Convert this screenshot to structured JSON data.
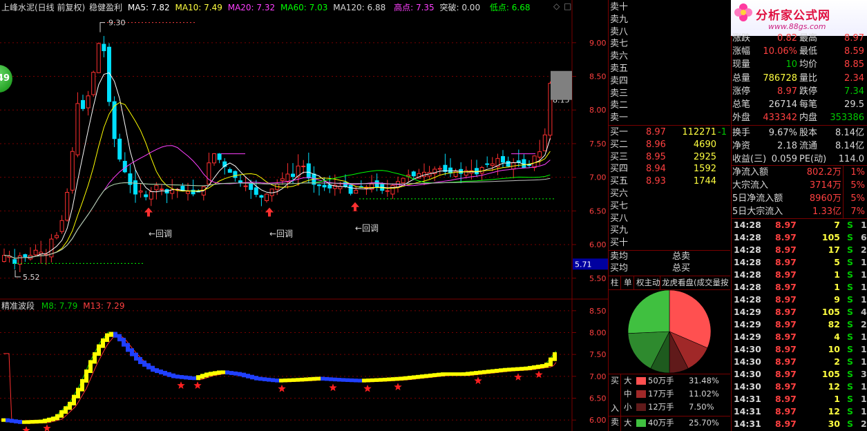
{
  "header": {
    "stock": "上峰水泥(日线 前复权)",
    "indicator": "稳健盈利",
    "ma5": "MA5: 7.82",
    "ma10": "MA10: 7.49",
    "ma20": "MA20: 7.32",
    "ma60": "MA60: 7.03",
    "ma120": "MA120: 6.88",
    "high": "高点: 7.35",
    "breakout": "突破: 0.00",
    "low": "低点: 6.68",
    "window_btn1": "◇",
    "window_btn2": "□"
  },
  "main_chart": {
    "label_high": "9.30",
    "label_low": "5.52",
    "label_last": "8.15",
    "badge": "49",
    "pullback_label": "←回调",
    "price_box": "5.71",
    "y_ticks": [
      "9.00",
      "8.50",
      "8.00",
      "7.50",
      "7.00",
      "6.50",
      "6.00",
      "5.50"
    ],
    "y_range": [
      5.2,
      9.45
    ]
  },
  "sub_chart": {
    "title": "精准波段",
    "m8": "M8: 7.79",
    "m13": "M13: 7.29",
    "y_ticks": [
      "8.50",
      "8.00",
      "7.50",
      "7.00",
      "6.50",
      "6.00"
    ],
    "y_range": [
      5.75,
      8.75
    ]
  },
  "colors": {
    "up": "#ff3030",
    "down": "#00e0ff",
    "grid": "#7a0000",
    "ma5": "#ffffff",
    "ma10": "#ffff00",
    "ma20": "#ff40ff",
    "ma60": "#00ff00",
    "ma120": "#c0c0c0"
  },
  "order_book": {
    "asks": [
      {
        "label": "卖十"
      },
      {
        "label": "卖九"
      },
      {
        "label": "卖八"
      },
      {
        "label": "卖七"
      },
      {
        "label": "卖六"
      },
      {
        "label": "卖五"
      },
      {
        "label": "卖四"
      },
      {
        "label": "卖三"
      },
      {
        "label": "卖二"
      },
      {
        "label": "卖一"
      }
    ],
    "bids": [
      {
        "label": "买一",
        "price": "8.97",
        "vol": "112271",
        "chg": "-1"
      },
      {
        "label": "买二",
        "price": "8.96",
        "vol": "4690",
        "chg": ""
      },
      {
        "label": "买三",
        "price": "8.95",
        "vol": "2925",
        "chg": ""
      },
      {
        "label": "买四",
        "price": "8.94",
        "vol": "1592",
        "chg": ""
      },
      {
        "label": "买五",
        "price": "8.93",
        "vol": "1744",
        "chg": ""
      },
      {
        "label": "买六",
        "price": "",
        "vol": "",
        "chg": ""
      },
      {
        "label": "买七",
        "price": "",
        "vol": "",
        "chg": ""
      },
      {
        "label": "买八",
        "price": "",
        "vol": "",
        "chg": ""
      },
      {
        "label": "买九",
        "price": "",
        "vol": "",
        "chg": ""
      },
      {
        "label": "买十",
        "price": "",
        "vol": "",
        "chg": ""
      }
    ],
    "avg_ask": "卖均",
    "avg_bid": "买均",
    "total_ask": "总卖",
    "total_bid": "总买"
  },
  "tabs": [
    "柱",
    "单",
    "权主动",
    "龙虎看盘(成交量按"
  ],
  "pie": {
    "slices": [
      {
        "value": 31.48,
        "color": "#ff5050"
      },
      {
        "value": 11.02,
        "color": "#a02828"
      },
      {
        "value": 7.5,
        "color": "#601a1a"
      },
      {
        "value": 7.5,
        "color": "#1e5a1e"
      },
      {
        "value": 16.8,
        "color": "#2e8a2e"
      },
      {
        "value": 25.7,
        "color": "#40c040"
      }
    ]
  },
  "flows": {
    "buy_label": "买",
    "buy_label2": "入",
    "sell_label": "卖",
    "rows": [
      {
        "size": "大",
        "swatch": "#ff5050",
        "label": "50万手",
        "pct": "31.48%"
      },
      {
        "size": "中",
        "swatch": "#a02828",
        "label": "17万手",
        "pct": "11.02%"
      },
      {
        "size": "小",
        "swatch": "#601a1a",
        "label": "12万手",
        "pct": "7.50%"
      },
      {
        "size": "大",
        "swatch": "#40c040",
        "label": "40万手",
        "pct": "25.70%"
      }
    ]
  },
  "banner": {
    "title": "分析家公式网",
    "url": "www.88gs.com"
  },
  "quote": {
    "rows": [
      {
        "l1": "涨跌",
        "v1": "0.82",
        "c1": "#ff4040",
        "l2": "最高",
        "v2": "8.97",
        "c2": "#ff4040"
      },
      {
        "l1": "涨幅",
        "v1": "10.06%",
        "c1": "#ff4040",
        "l2": "最低",
        "v2": "8.59",
        "c2": "#ff4040"
      },
      {
        "l1": "现量",
        "v1": "10",
        "c1": "#00c800",
        "l2": "均价",
        "v2": "8.85",
        "c2": "#ff4040"
      },
      {
        "l1": "总量",
        "v1": "786728",
        "c1": "#ffff40",
        "l2": "量比",
        "v2": "2.34",
        "c2": "#ff4040"
      },
      {
        "l1": "涨停",
        "v1": "8.97",
        "c1": "#ff4040",
        "l2": "跌停",
        "v2": "7.34",
        "c2": "#00c800"
      },
      {
        "l1": "总笔",
        "v1": "26714",
        "c1": "#d8d8d8",
        "l2": "每笔",
        "v2": "29.5",
        "c2": "#d8d8d8"
      },
      {
        "l1": "外盘",
        "v1": "433342",
        "c1": "#ff4040",
        "l2": "内盘",
        "v2": "353386",
        "c2": "#00c800"
      },
      {
        "l1": "换手",
        "v1": "9.67%",
        "c1": "#d8d8d8",
        "l2": "股本",
        "v2": "8.14亿",
        "c2": "#d8d8d8"
      },
      {
        "l1": "净资",
        "v1": "2.18",
        "c1": "#d8d8d8",
        "l2": "流通",
        "v2": "8.14亿",
        "c2": "#d8d8d8"
      },
      {
        "l1": "收益(三)",
        "v1": "0.059",
        "c1": "#d8d8d8",
        "l2": "PE(动)",
        "v2": "114.0",
        "c2": "#d8d8d8"
      }
    ]
  },
  "fund_flow": [
    {
      "label": "净流入额",
      "value": "802.2万",
      "pct": "1%"
    },
    {
      "label": "大宗流入",
      "value": "3714万",
      "pct": "5%"
    },
    {
      "label": "5日净流入额",
      "value": "8960万",
      "pct": "5%"
    },
    {
      "label": "5日大宗流入",
      "value": "1.33亿",
      "pct": "7%"
    }
  ],
  "ticks": [
    {
      "time": "14:28",
      "price": "8.97",
      "vol": "7",
      "dir": "S",
      "n": "1"
    },
    {
      "time": "14:28",
      "price": "8.97",
      "vol": "105",
      "dir": "S",
      "n": "6"
    },
    {
      "time": "14:28",
      "price": "8.97",
      "vol": "17",
      "dir": "S",
      "n": "2"
    },
    {
      "time": "14:28",
      "price": "8.97",
      "vol": "5",
      "dir": "S",
      "n": "1"
    },
    {
      "time": "14:28",
      "price": "8.97",
      "vol": "1",
      "dir": "S",
      "n": "1"
    },
    {
      "time": "14:28",
      "price": "8.97",
      "vol": "1",
      "dir": "S",
      "n": "1"
    },
    {
      "time": "14:28",
      "price": "8.97",
      "vol": "9",
      "dir": "S",
      "n": "1"
    },
    {
      "time": "14:29",
      "price": "8.97",
      "vol": "105",
      "dir": "S",
      "n": "4"
    },
    {
      "time": "14:29",
      "price": "8.97",
      "vol": "82",
      "dir": "S",
      "n": "2"
    },
    {
      "time": "14:29",
      "price": "8.97",
      "vol": "4",
      "dir": "S",
      "n": "1"
    },
    {
      "time": "14:30",
      "price": "8.97",
      "vol": "10",
      "dir": "S",
      "n": "1"
    },
    {
      "time": "14:30",
      "price": "8.97",
      "vol": "2",
      "dir": "S",
      "n": "1"
    },
    {
      "time": "14:30",
      "price": "8.97",
      "vol": "105",
      "dir": "S",
      "n": "3"
    },
    {
      "time": "14:30",
      "price": "8.97",
      "vol": "12",
      "dir": "S",
      "n": "1"
    },
    {
      "time": "14:31",
      "price": "8.97",
      "vol": "1",
      "dir": "S",
      "n": "1"
    },
    {
      "time": "14:31",
      "price": "8.97",
      "vol": "12",
      "dir": "S",
      "n": "1"
    },
    {
      "time": "14:31",
      "price": "8.97",
      "vol": "30",
      "dir": "S",
      "n": "2"
    }
  ]
}
